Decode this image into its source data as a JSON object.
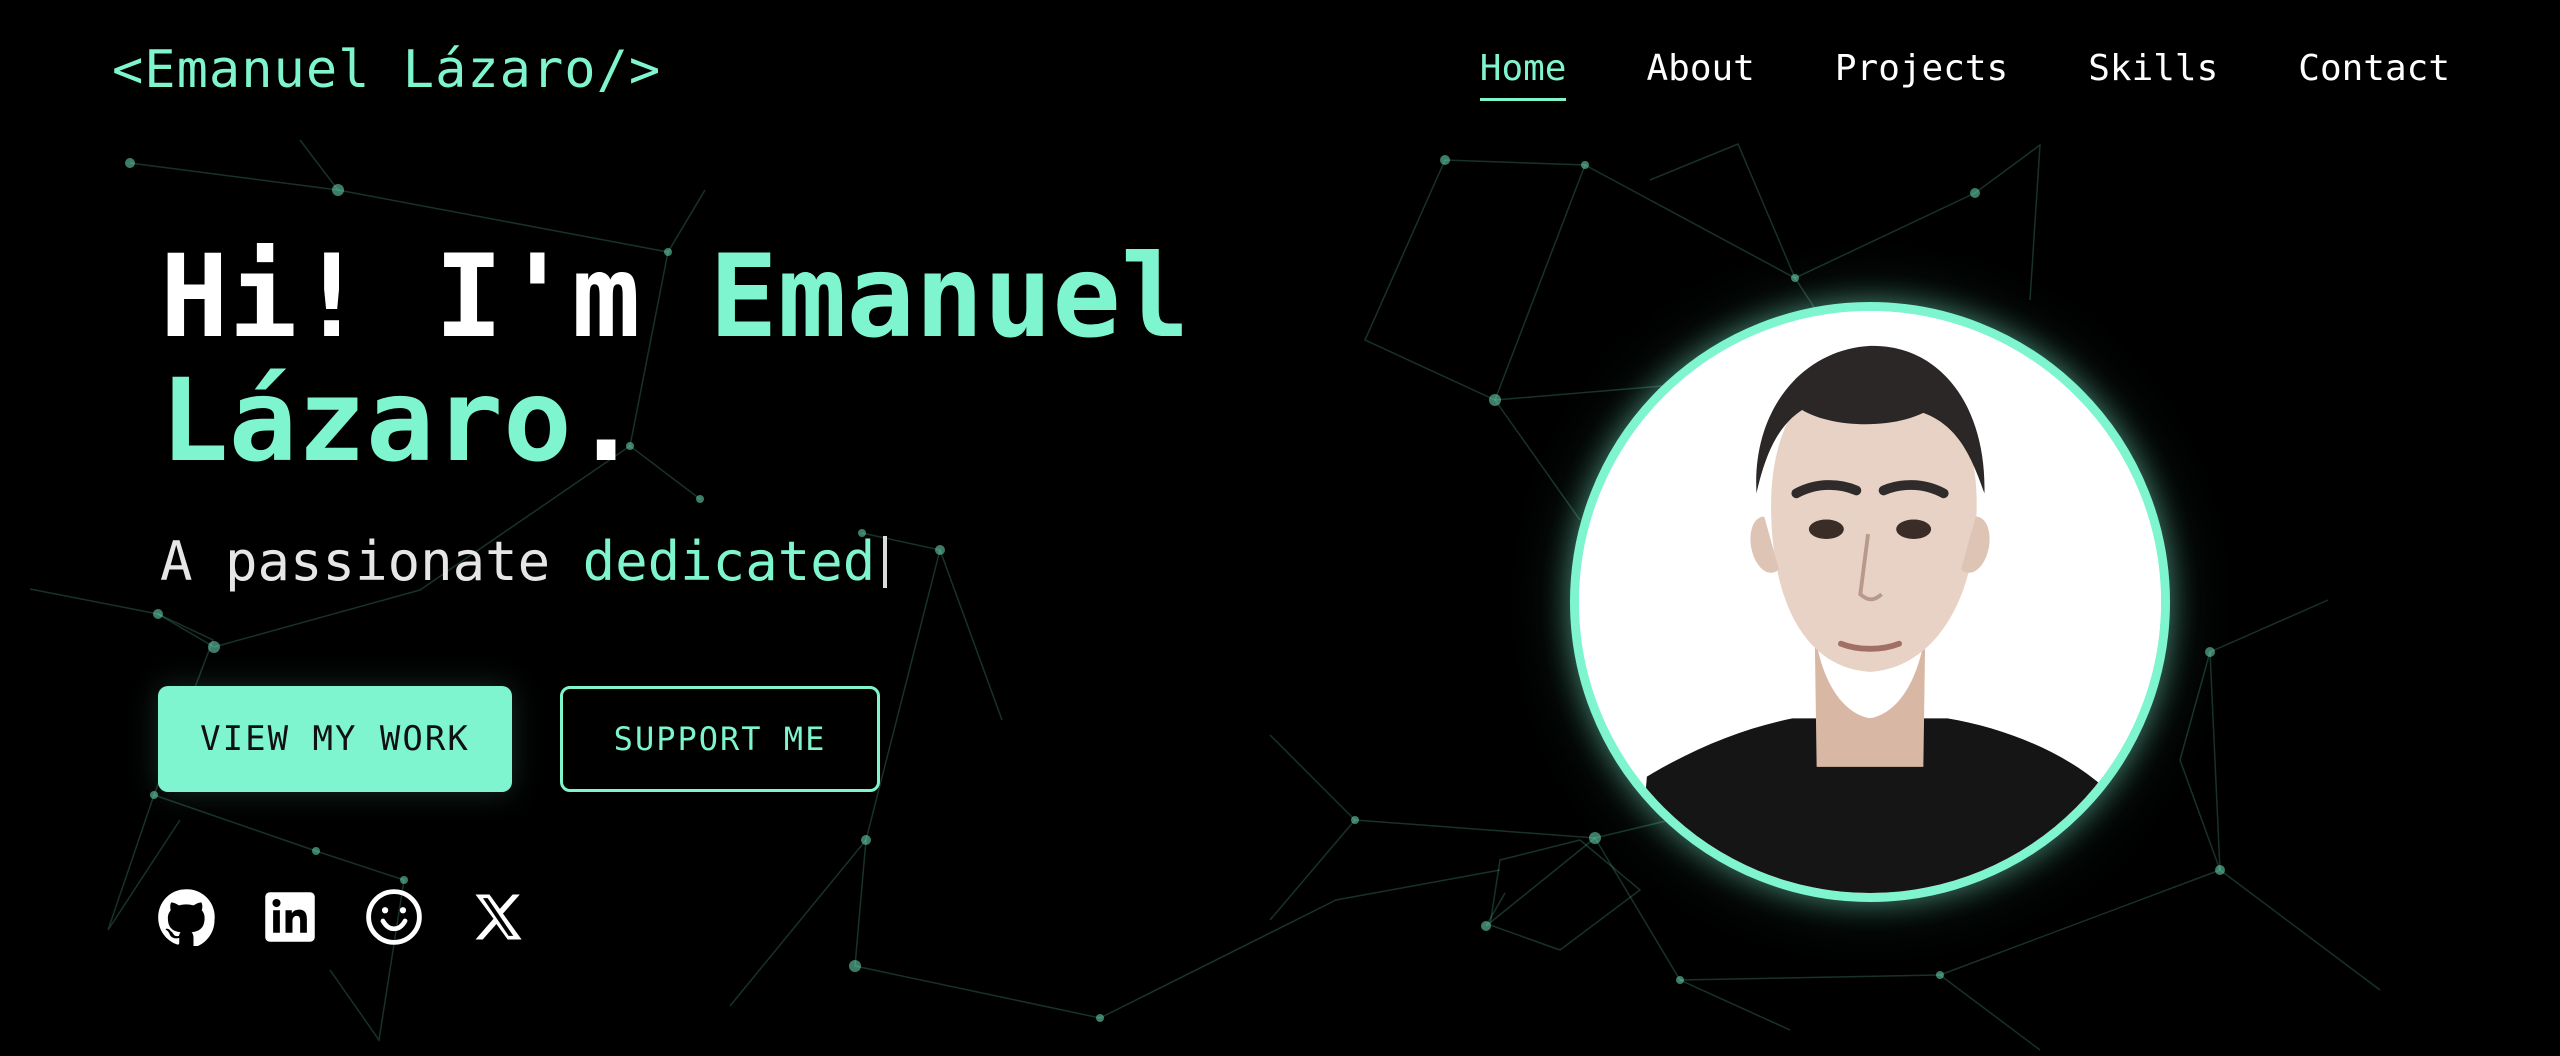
{
  "header": {
    "logo_text": "<Emanuel Lázaro/>",
    "nav": [
      {
        "label": "Home",
        "active": true
      },
      {
        "label": "About",
        "active": false
      },
      {
        "label": "Projects",
        "active": false
      },
      {
        "label": "Skills",
        "active": false
      },
      {
        "label": "Contact",
        "active": false
      }
    ]
  },
  "hero": {
    "greeting": "Hi! I'm ",
    "name_first": "Emanuel",
    "name_last": "Lázaro",
    "name_end": ".",
    "subtitle_prefix": "A passionate ",
    "subtitle_typed": "dedicated",
    "primary_button": "VIEW MY WORK",
    "secondary_button": "SUPPORT ME"
  },
  "socials": [
    {
      "icon": "github-icon"
    },
    {
      "icon": "linkedin-icon"
    },
    {
      "icon": "smile-icon"
    },
    {
      "icon": "x-icon"
    }
  ],
  "colors": {
    "accent": "#7ff5cf",
    "background": "#000000",
    "text": "#ffffff"
  }
}
